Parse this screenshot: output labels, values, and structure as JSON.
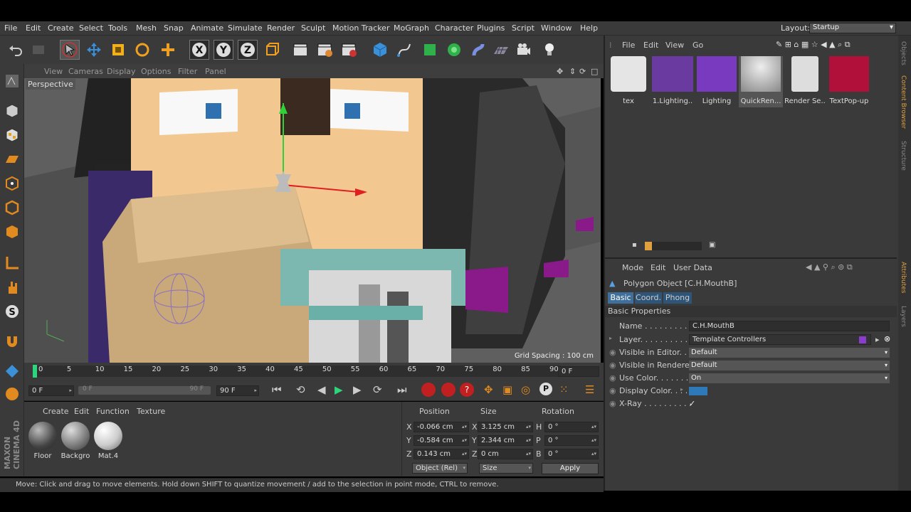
{
  "menu": [
    "File",
    "Edit",
    "Create",
    "Select",
    "Tools",
    "Mesh",
    "Snap",
    "Animate",
    "Simulate",
    "Render",
    "Sculpt",
    "Motion Tracker",
    "MoGraph",
    "Character",
    "Plugins",
    "Script",
    "Window",
    "Help"
  ],
  "layout": {
    "label": "Layout:",
    "value": "Startup"
  },
  "viewport": {
    "menu": [
      "View",
      "Cameras",
      "Display",
      "Options",
      "Filter",
      "Panel"
    ],
    "label": "Perspective",
    "grid_spacing": "Grid Spacing : 100 cm"
  },
  "timeline": {
    "ticks": [
      "0",
      "5",
      "10",
      "15",
      "20",
      "25",
      "30",
      "35",
      "40",
      "45",
      "50",
      "55",
      "60",
      "65",
      "70",
      "75",
      "80",
      "85",
      "90"
    ],
    "current_frame": "0 F"
  },
  "anim": {
    "start": "0 F",
    "range_start": "0 F",
    "range_end": "90 F",
    "end": "90 F"
  },
  "materials": {
    "menu": [
      "Create",
      "Edit",
      "Function",
      "Texture"
    ],
    "items": [
      {
        "name": "Floor"
      },
      {
        "name": "Backgro"
      },
      {
        "name": "Mat.4"
      }
    ]
  },
  "coords": {
    "headers": {
      "position": "Position",
      "size": "Size",
      "rotation": "Rotation"
    },
    "rows": [
      {
        "axis": "X",
        "pos": "-0.066 cm",
        "size_axis": "X",
        "size": "3.125 cm",
        "rot_axis": "H",
        "rot": "0 °"
      },
      {
        "axis": "Y",
        "pos": "-0.584 cm",
        "size_axis": "Y",
        "size": "2.344 cm",
        "rot_axis": "P",
        "rot": "0 °"
      },
      {
        "axis": "Z",
        "pos": "0.143 cm",
        "size_axis": "Z",
        "size": "0 cm",
        "rot_axis": "B",
        "rot": "0 °"
      }
    ],
    "object_mode": "Object (Rel)",
    "size_mode": "Size",
    "apply": "Apply"
  },
  "status": "Move: Click and drag to move elements. Hold down SHIFT to quantize movement / add to the selection in point mode, CTRL to remove.",
  "content_browser": {
    "menu": [
      "File",
      "Edit",
      "View",
      "Go"
    ],
    "items": [
      {
        "name": "tex",
        "color": "#d8d8d8"
      },
      {
        "name": "1.Lighting..",
        "color": "#5b2a9a"
      },
      {
        "name": "Lighting",
        "color": "#6a2fb0"
      },
      {
        "name": "QuickRen...",
        "color": "#bcbcbc"
      },
      {
        "name": "Render Se..",
        "color": "#e0e0e0"
      },
      {
        "name": "TextPop-up",
        "color": "#b0103a"
      }
    ]
  },
  "attributes": {
    "menu": [
      "Mode",
      "Edit",
      "User Data"
    ],
    "object_title": "Polygon Object [C.H.MouthB]",
    "tabs": [
      "Basic",
      "Coord.",
      "Phong"
    ],
    "section": "Basic Properties",
    "props": [
      {
        "label": "Name . . . . . . . . . . . .",
        "value": "C.H.MouthB"
      },
      {
        "label": "Layer. . . . . . . . . . . .",
        "value": "Template Controllers"
      },
      {
        "label": "Visible in Editor. .",
        "value": "Default"
      },
      {
        "label": "Visible in Renderer",
        "value": "Default"
      },
      {
        "label": "Use Color. . . . . . . .",
        "value": "On"
      },
      {
        "label": "Display Color. . . .",
        "value": ""
      },
      {
        "label": "X-Ray . . . . . . . . . .",
        "value": "✓"
      }
    ]
  },
  "side_tabs": [
    "Objects",
    "Content Browser",
    "Structure",
    "Attributes",
    "Layers"
  ],
  "brand": "MAXON CINEMA 4D",
  "colors": {
    "accent": "#2b5d8a",
    "layer": "#8a3ccf",
    "display_color": "#2e7ab8"
  }
}
